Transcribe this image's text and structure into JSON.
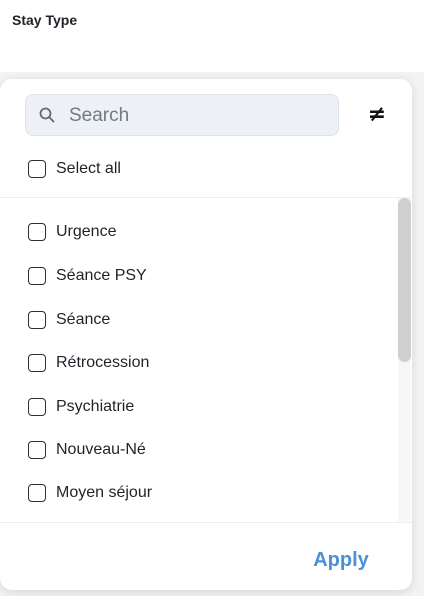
{
  "header": {
    "title": "Stay Type"
  },
  "filter": {
    "search": {
      "placeholder": "Search",
      "icon": "search-icon"
    },
    "exclude_toggle": {
      "symbol": "≠",
      "icon": "not-equal-icon"
    },
    "select_all": {
      "label": "Select all",
      "checked": false
    },
    "options": [
      {
        "label": "Urgence",
        "checked": false
      },
      {
        "label": "Séance PSY",
        "checked": false
      },
      {
        "label": "Séance",
        "checked": false
      },
      {
        "label": "Rétrocession",
        "checked": false
      },
      {
        "label": "Psychiatrie",
        "checked": false
      },
      {
        "label": "Nouveau-Né",
        "checked": false
      },
      {
        "label": "Moyen séjour",
        "checked": false
      }
    ],
    "apply_label": "Apply"
  },
  "colors": {
    "accent": "#4a90d9",
    "search_bg": "#edf1f6",
    "checkbox_border": "#2b2f36"
  }
}
